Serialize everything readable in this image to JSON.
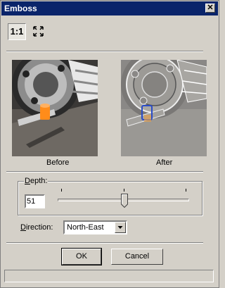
{
  "window": {
    "title": "Emboss",
    "close_glyph": "✕"
  },
  "toolbar": {
    "actual_size_label": "1:1",
    "fit_icon": "fit-to-window-icon"
  },
  "preview": {
    "before_label": "Before",
    "after_label": "After"
  },
  "depth": {
    "label_underlined": "D",
    "label_rest": "epth:",
    "value": "51",
    "slider_min": 0,
    "slider_max": 100,
    "slider_value": 51
  },
  "direction": {
    "label_underlined": "D",
    "label_rest": "irection:",
    "selected": "North-East"
  },
  "buttons": {
    "ok": "OK",
    "cancel": "Cancel"
  }
}
